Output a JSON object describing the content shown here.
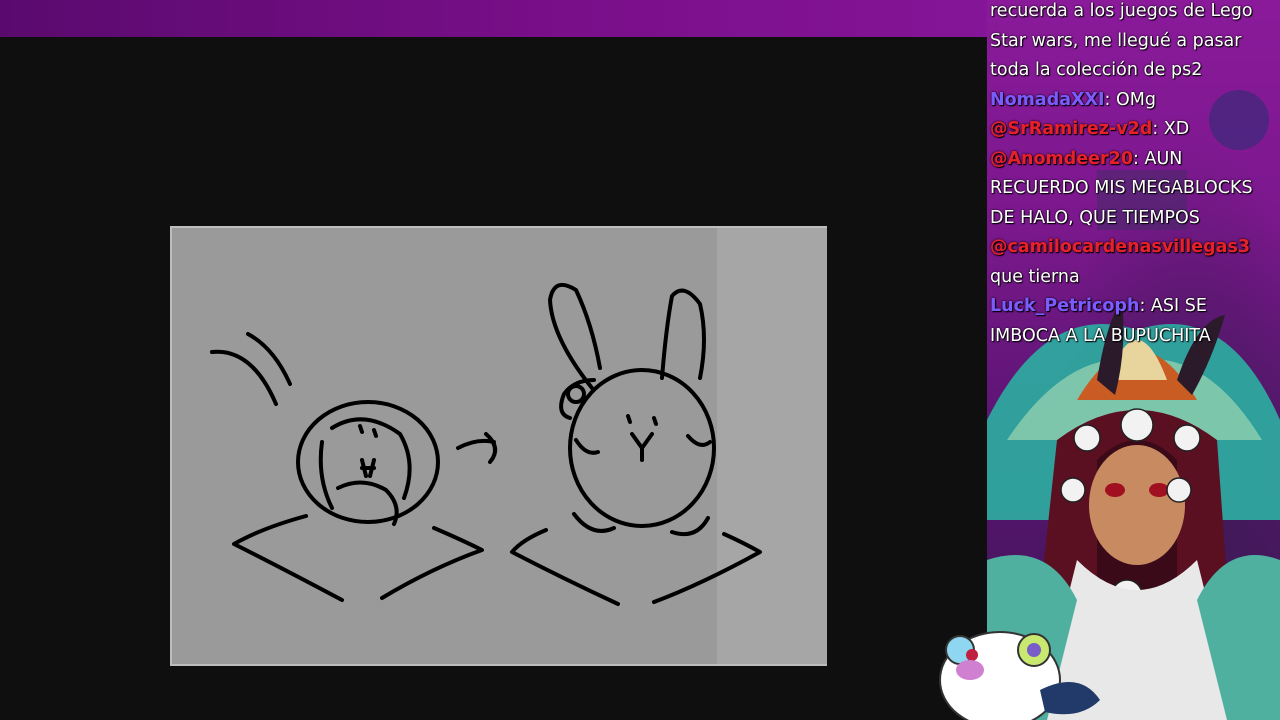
{
  "chat": {
    "messages": [
      {
        "user": "",
        "user_color": "#ffffff",
        "text": "recuerda a los juegos de Lego Star wars, me llegué a pasar toda la colección de ps2"
      },
      {
        "user": "NomadaXXI",
        "user_color": "#7a5cff",
        "text": ": OMg"
      },
      {
        "user": "@SrRamirez-v2d",
        "user_color": "#e8202a",
        "text": ": XD"
      },
      {
        "user": "@Anomdeer20",
        "user_color": "#e8202a",
        "text": ": AUN RECUERDO MIS MEGABLOCKS DE HALO, QUE TIEMPOS"
      },
      {
        "user": "@camilocardenasvillegas3",
        "user_color": "#e8202a",
        "text": ""
      },
      {
        "user": "",
        "user_color": "#ffffff",
        "text": "que tierna"
      },
      {
        "user": "Luck_Petricoph",
        "user_color": "#7a5cff",
        "text": ": ASI SE IMBOCA A LA BUPUCHITA"
      }
    ]
  },
  "colors": {
    "top_bar": "#6e0d80",
    "stage_bg": "#0f0f0f",
    "canvas_bg": "#9a9a9a",
    "ink": "#000000"
  },
  "icons": {
    "mascot": "round-creature-mascot-icon",
    "avatar": "vtuber-avatar"
  }
}
